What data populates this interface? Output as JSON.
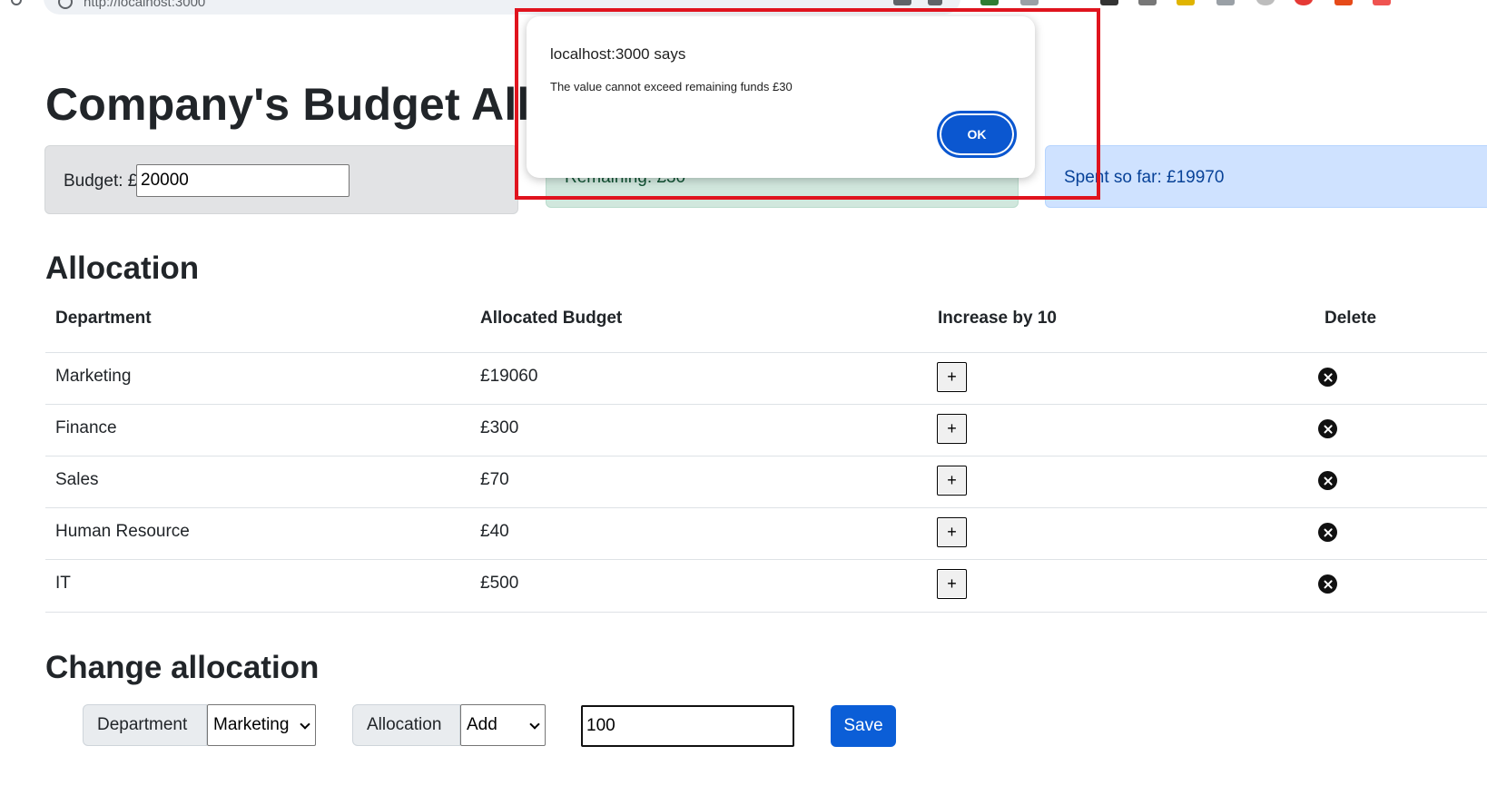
{
  "browser": {
    "url": "http://localhost:3000"
  },
  "page": {
    "title": "Company's Budget Allo",
    "budget": {
      "label": "Budget: £",
      "value": "20000"
    },
    "remaining": {
      "label": "Remaining: £30"
    },
    "spent": {
      "label": "Spent so far: £19970"
    }
  },
  "allocation": {
    "heading": "Allocation",
    "columns": [
      "Department",
      "Allocated Budget",
      "Increase by 10",
      "Delete"
    ],
    "rows": [
      {
        "department": "Marketing",
        "budget": "£19060",
        "increase": "+"
      },
      {
        "department": "Finance",
        "budget": "£300",
        "increase": "+"
      },
      {
        "department": "Sales",
        "budget": "£70",
        "increase": "+"
      },
      {
        "department": "Human Resource",
        "budget": "£40",
        "increase": "+"
      },
      {
        "department": "IT",
        "budget": "£500",
        "increase": "+"
      }
    ]
  },
  "change_allocation": {
    "heading": "Change allocation",
    "department_label": "Department",
    "department_selected": "Marketing",
    "allocation_label": "Allocation",
    "allocation_selected": "Add",
    "amount": "100",
    "save_label": "Save"
  },
  "dialog": {
    "title": "localhost:3000 says",
    "message": "The value cannot exceed remaining funds  £30",
    "ok_label": "OK"
  },
  "colors": {
    "highlight": "#e0141e",
    "ok_button": "#0b57d0",
    "save_button": "#0b5ed7"
  }
}
